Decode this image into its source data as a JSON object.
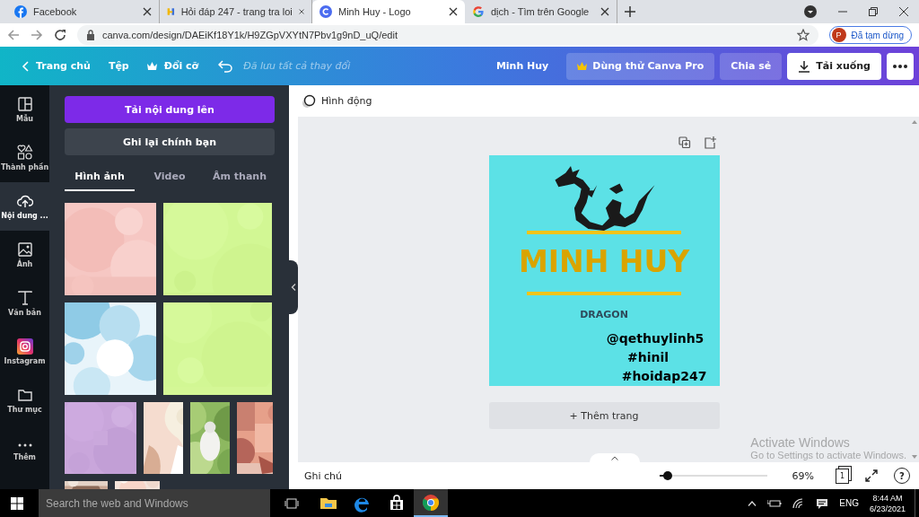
{
  "browser": {
    "tabs": [
      {
        "title": "Facebook",
        "selected": false
      },
      {
        "title": "Hỏi đáp 247 - trang tra loi",
        "selected": false
      },
      {
        "title": "Minh Huy - Logo",
        "selected": true
      },
      {
        "title": "dịch - Tìm trên Google",
        "selected": false
      }
    ],
    "address": "canva.com/design/DAEiKf18Y1k/H9ZGpVXYtN7Pbv1g9nD_uQ/edit",
    "profile": {
      "initial": "P",
      "label": "Đã tạm dừng"
    }
  },
  "topbar": {
    "home": "Trang chủ",
    "file": "Tệp",
    "resize": "Đổi cỡ",
    "saved": "Đã lưu tất cả thay đổi",
    "title": "Minh Huy",
    "pro": "Dùng thử Canva Pro",
    "share": "Chia sẻ",
    "download": "Tải xuống"
  },
  "rail": [
    {
      "label": "Mẫu",
      "selected": false
    },
    {
      "label": "Thành phần",
      "selected": false
    },
    {
      "label": "Nội dung ...",
      "selected": true
    },
    {
      "label": "Ảnh",
      "selected": false
    },
    {
      "label": "Văn bản",
      "selected": false
    },
    {
      "label": "Instagram",
      "selected": false
    },
    {
      "label": "Thư mục",
      "selected": false
    },
    {
      "label": "Thêm",
      "selected": false
    }
  ],
  "panel": {
    "upload_button": "Tải nội dung lên",
    "record_button": "Ghi lại chính bạn",
    "tabs": [
      {
        "label": "Hình ảnh",
        "selected": true
      },
      {
        "label": "Video",
        "selected": false
      },
      {
        "label": "Âm thanh",
        "selected": false
      }
    ]
  },
  "editor": {
    "animate": "Hình động",
    "design": {
      "title": "MINH HUY",
      "subtitle": "DRAGON",
      "tags": [
        "@qethuylinh5",
        "#hinil",
        "#hoidap247"
      ]
    },
    "add_page": "+ Thêm trang",
    "notes": "Ghi chú",
    "zoom": {
      "level": 0.08,
      "reading": "69%"
    },
    "page_count": "1",
    "help": "?",
    "notice": {
      "title": "Activate Windows",
      "text": "Go to Settings to activate Windows."
    }
  },
  "taskbar": {
    "search": {
      "placeholder": "Search the web and Windows"
    },
    "apps": [
      {
        "selected": false
      },
      {
        "selected": false
      },
      {
        "selected": false
      },
      {
        "selected": true
      }
    ],
    "language": "ENG",
    "time": "8:44 AM",
    "date": "6/23/2021"
  }
}
